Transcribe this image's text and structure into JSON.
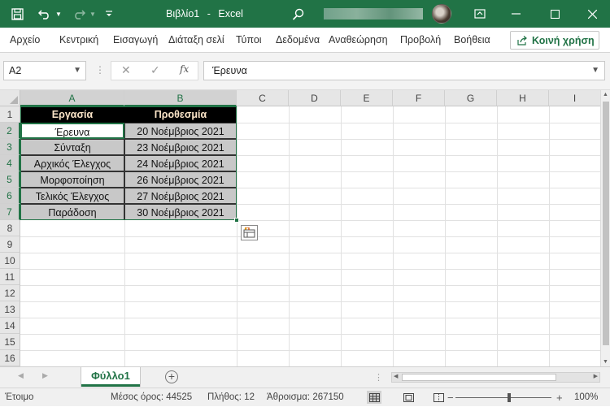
{
  "titlebar": {
    "doc_title": "Βιβλίο1",
    "separator": "-",
    "app_name": "Excel"
  },
  "ribbon": {
    "tabs": [
      "Αρχείο",
      "Κεντρική",
      "Εισαγωγή",
      "Διάταξη σελί",
      "Τύποι",
      "Δεδομένα",
      "Αναθεώρηση",
      "Προβολή",
      "Βοήθεια"
    ],
    "share_label": "Κοινή χρήση"
  },
  "formula_bar": {
    "name_box": "A2",
    "fx_symbol": "fx",
    "formula": "Έρευνα"
  },
  "sheet": {
    "columns": [
      "A",
      "B",
      "C",
      "D",
      "E",
      "F",
      "G",
      "H",
      "I"
    ],
    "rows": [
      "1",
      "2",
      "3",
      "4",
      "5",
      "6",
      "7",
      "8",
      "9",
      "10",
      "11",
      "12",
      "13",
      "14",
      "15",
      "16"
    ],
    "header": [
      "Εργασία",
      "Προθεσμία"
    ],
    "data": [
      [
        "Έρευνα",
        "20 Νοέμβριος 2021"
      ],
      [
        "Σύνταξη",
        "23 Νοέμβριος 2021"
      ],
      [
        "Αρχικός Έλεγχος",
        "24 Νοέμβριος 2021"
      ],
      [
        "Μορφοποίηση",
        "26 Νοέμβριος 2021"
      ],
      [
        "Τελικός Έλεγχος",
        "27 Νοέμβριος 2021"
      ],
      [
        "Παράδοση",
        "30 Νοέμβριος 2021"
      ]
    ]
  },
  "sheet_tabs": {
    "active": "Φύλλο1"
  },
  "status": {
    "ready": "Έτοιμο",
    "average": "Μέσος όρος: 44525",
    "count": "Πλήθος: 12",
    "sum": "Άθροισμα: 267150",
    "zoom": "100%"
  },
  "colors": {
    "excel_green": "#217346",
    "header_fill": "#000000",
    "header_text": "#fbe5c8",
    "body_fill": "#c8c8c8"
  }
}
